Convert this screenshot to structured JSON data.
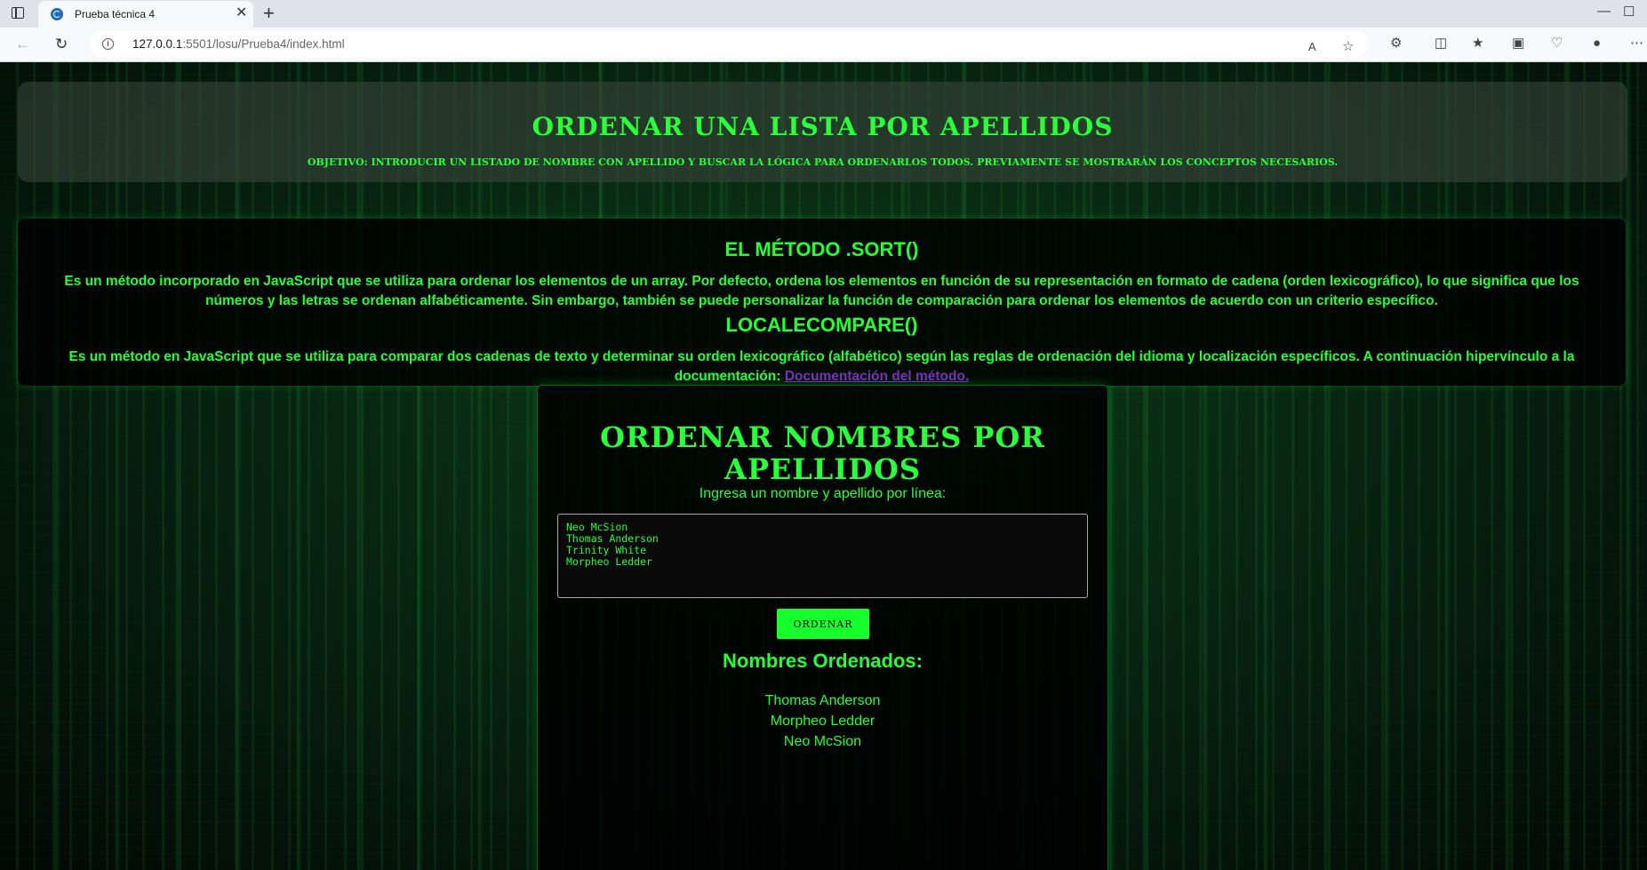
{
  "browser": {
    "tab_title": "Prueba técnica 4",
    "url_host": "127.0.0.1",
    "url_rest": ":5501/losu/Prueba4/index.html"
  },
  "header": {
    "title": "ORDENAR UNA LISTA POR APELLIDOS",
    "subtitle": "OBJETIVO: INTRODUCIR UN LISTADO DE NOMBRE CON APELLIDO Y BUSCAR LA LÓGICA PARA ORDENARLOS TODOS. PREVIAMENTE SE MOSTRARÁN LOS CONCEPTOS NECESARIOS."
  },
  "concepts": {
    "sort_title": "EL MÉTODO .SORT()",
    "sort_text": "Es un método incorporado en JavaScript que se utiliza para ordenar los elementos de un array. Por defecto, ordena los elementos en función de su representación en formato de cadena (orden lexicográfico), lo que significa que los números y las letras se ordenan alfabéticamente. Sin embargo, también se puede personalizar la función de comparación para ordenar los elementos de acuerdo con un criterio específico.",
    "locale_title": "LOCALECOMPARE()",
    "locale_text": "Es un método en JavaScript que se utiliza para comparar dos cadenas de texto y determinar su orden lexicográfico (alfabético) según las reglas de ordenación del idioma y localización específicos. A continuación hipervínculo a la documentación: ",
    "doc_link": "Documentación del método."
  },
  "sorter": {
    "title": "ORDENAR NOMBRES POR APELLIDOS",
    "input_label": "Ingresa un nombre y apellido por línea:",
    "input_value": "Neo McSion\nThomas Anderson\nTrinity White\nMorpheo Ledder",
    "button_label": "ORDENAR",
    "result_title": "Nombres Ordenados:",
    "results": [
      "Thomas Anderson",
      "Morpheo Ledder",
      "Neo McSion"
    ]
  }
}
